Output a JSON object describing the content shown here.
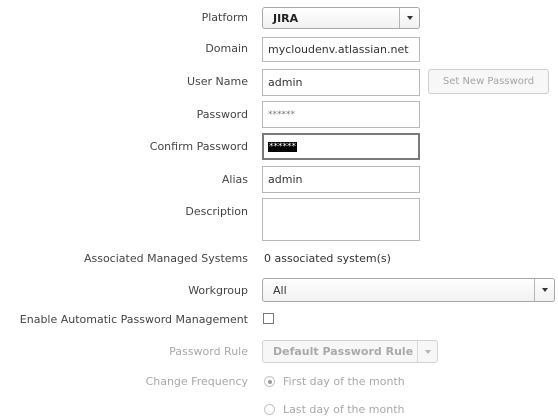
{
  "form": {
    "platform": {
      "label": "Platform",
      "value": "JIRA"
    },
    "domain": {
      "label": "Domain",
      "value": "mycloudenv.atlassian.net"
    },
    "username": {
      "label": "User Name",
      "value": "admin",
      "button": "Set New Password"
    },
    "password": {
      "label": "Password",
      "value": "******"
    },
    "confirm_password": {
      "label": "Confirm Password",
      "value": "******"
    },
    "alias": {
      "label": "Alias",
      "value": "admin"
    },
    "description": {
      "label": "Description",
      "value": ""
    },
    "associated_systems": {
      "label": "Associated Managed Systems",
      "value": "0 associated system(s)"
    },
    "workgroup": {
      "label": "Workgroup",
      "value": "All"
    },
    "auto_password": {
      "label": "Enable Automatic Password Management",
      "checked": false
    },
    "password_rule": {
      "label": "Password Rule",
      "value": "Default Password Rule"
    },
    "change_frequency": {
      "label": "Change Frequency",
      "options": [
        "First day of the month",
        "Last day of the month"
      ],
      "selected": 0
    }
  }
}
